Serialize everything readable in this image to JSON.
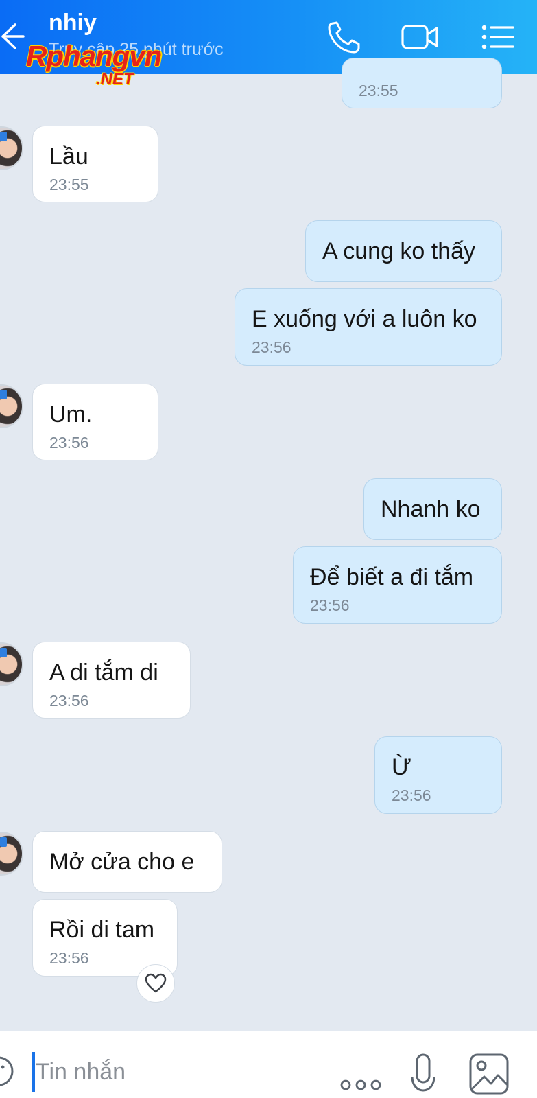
{
  "header": {
    "contact_name": "nhiy",
    "status": "Truy cập 25 phút trước",
    "icons": [
      "back-arrow-icon",
      "phone-icon",
      "video-camera-icon",
      "menu-list-icon"
    ]
  },
  "watermark": {
    "main": "Rphangvn",
    "sub": ".NET"
  },
  "messages": [
    {
      "from": "me",
      "text": "",
      "time": "23:55"
    },
    {
      "from": "contact",
      "text": "Lầu",
      "time": "23:55"
    },
    {
      "from": "me",
      "text": "A cung ko thấy",
      "time": ""
    },
    {
      "from": "me",
      "text": "E xuống với a luôn ko",
      "time": "23:56"
    },
    {
      "from": "contact",
      "text": "Um.",
      "time": "23:56"
    },
    {
      "from": "me",
      "text": "Nhanh ko",
      "time": ""
    },
    {
      "from": "me",
      "text": "Để biết a đi tắm",
      "time": "23:56"
    },
    {
      "from": "contact",
      "text": " A di tắm di",
      "time": "23:56"
    },
    {
      "from": "me",
      "text": "Ừ",
      "time": "23:56"
    },
    {
      "from": "contact",
      "text": "Mở cửa cho e",
      "time": ""
    },
    {
      "from": "contact",
      "text": "Rồi di tam",
      "time": "23:56"
    }
  ],
  "reaction": {
    "icon": "heart-outline-icon"
  },
  "input_bar": {
    "placeholder": "Tin nhắn",
    "icons": [
      "sticker-icon",
      "more-dots-icon",
      "microphone-icon",
      "image-icon"
    ]
  },
  "colors": {
    "header_gradient_start": "#0a6cf5",
    "header_gradient_end": "#25b3f7",
    "outgoing_bubble": "#d5ecfd",
    "incoming_bubble": "#ffffff",
    "chat_background": "#e3e9f1"
  }
}
